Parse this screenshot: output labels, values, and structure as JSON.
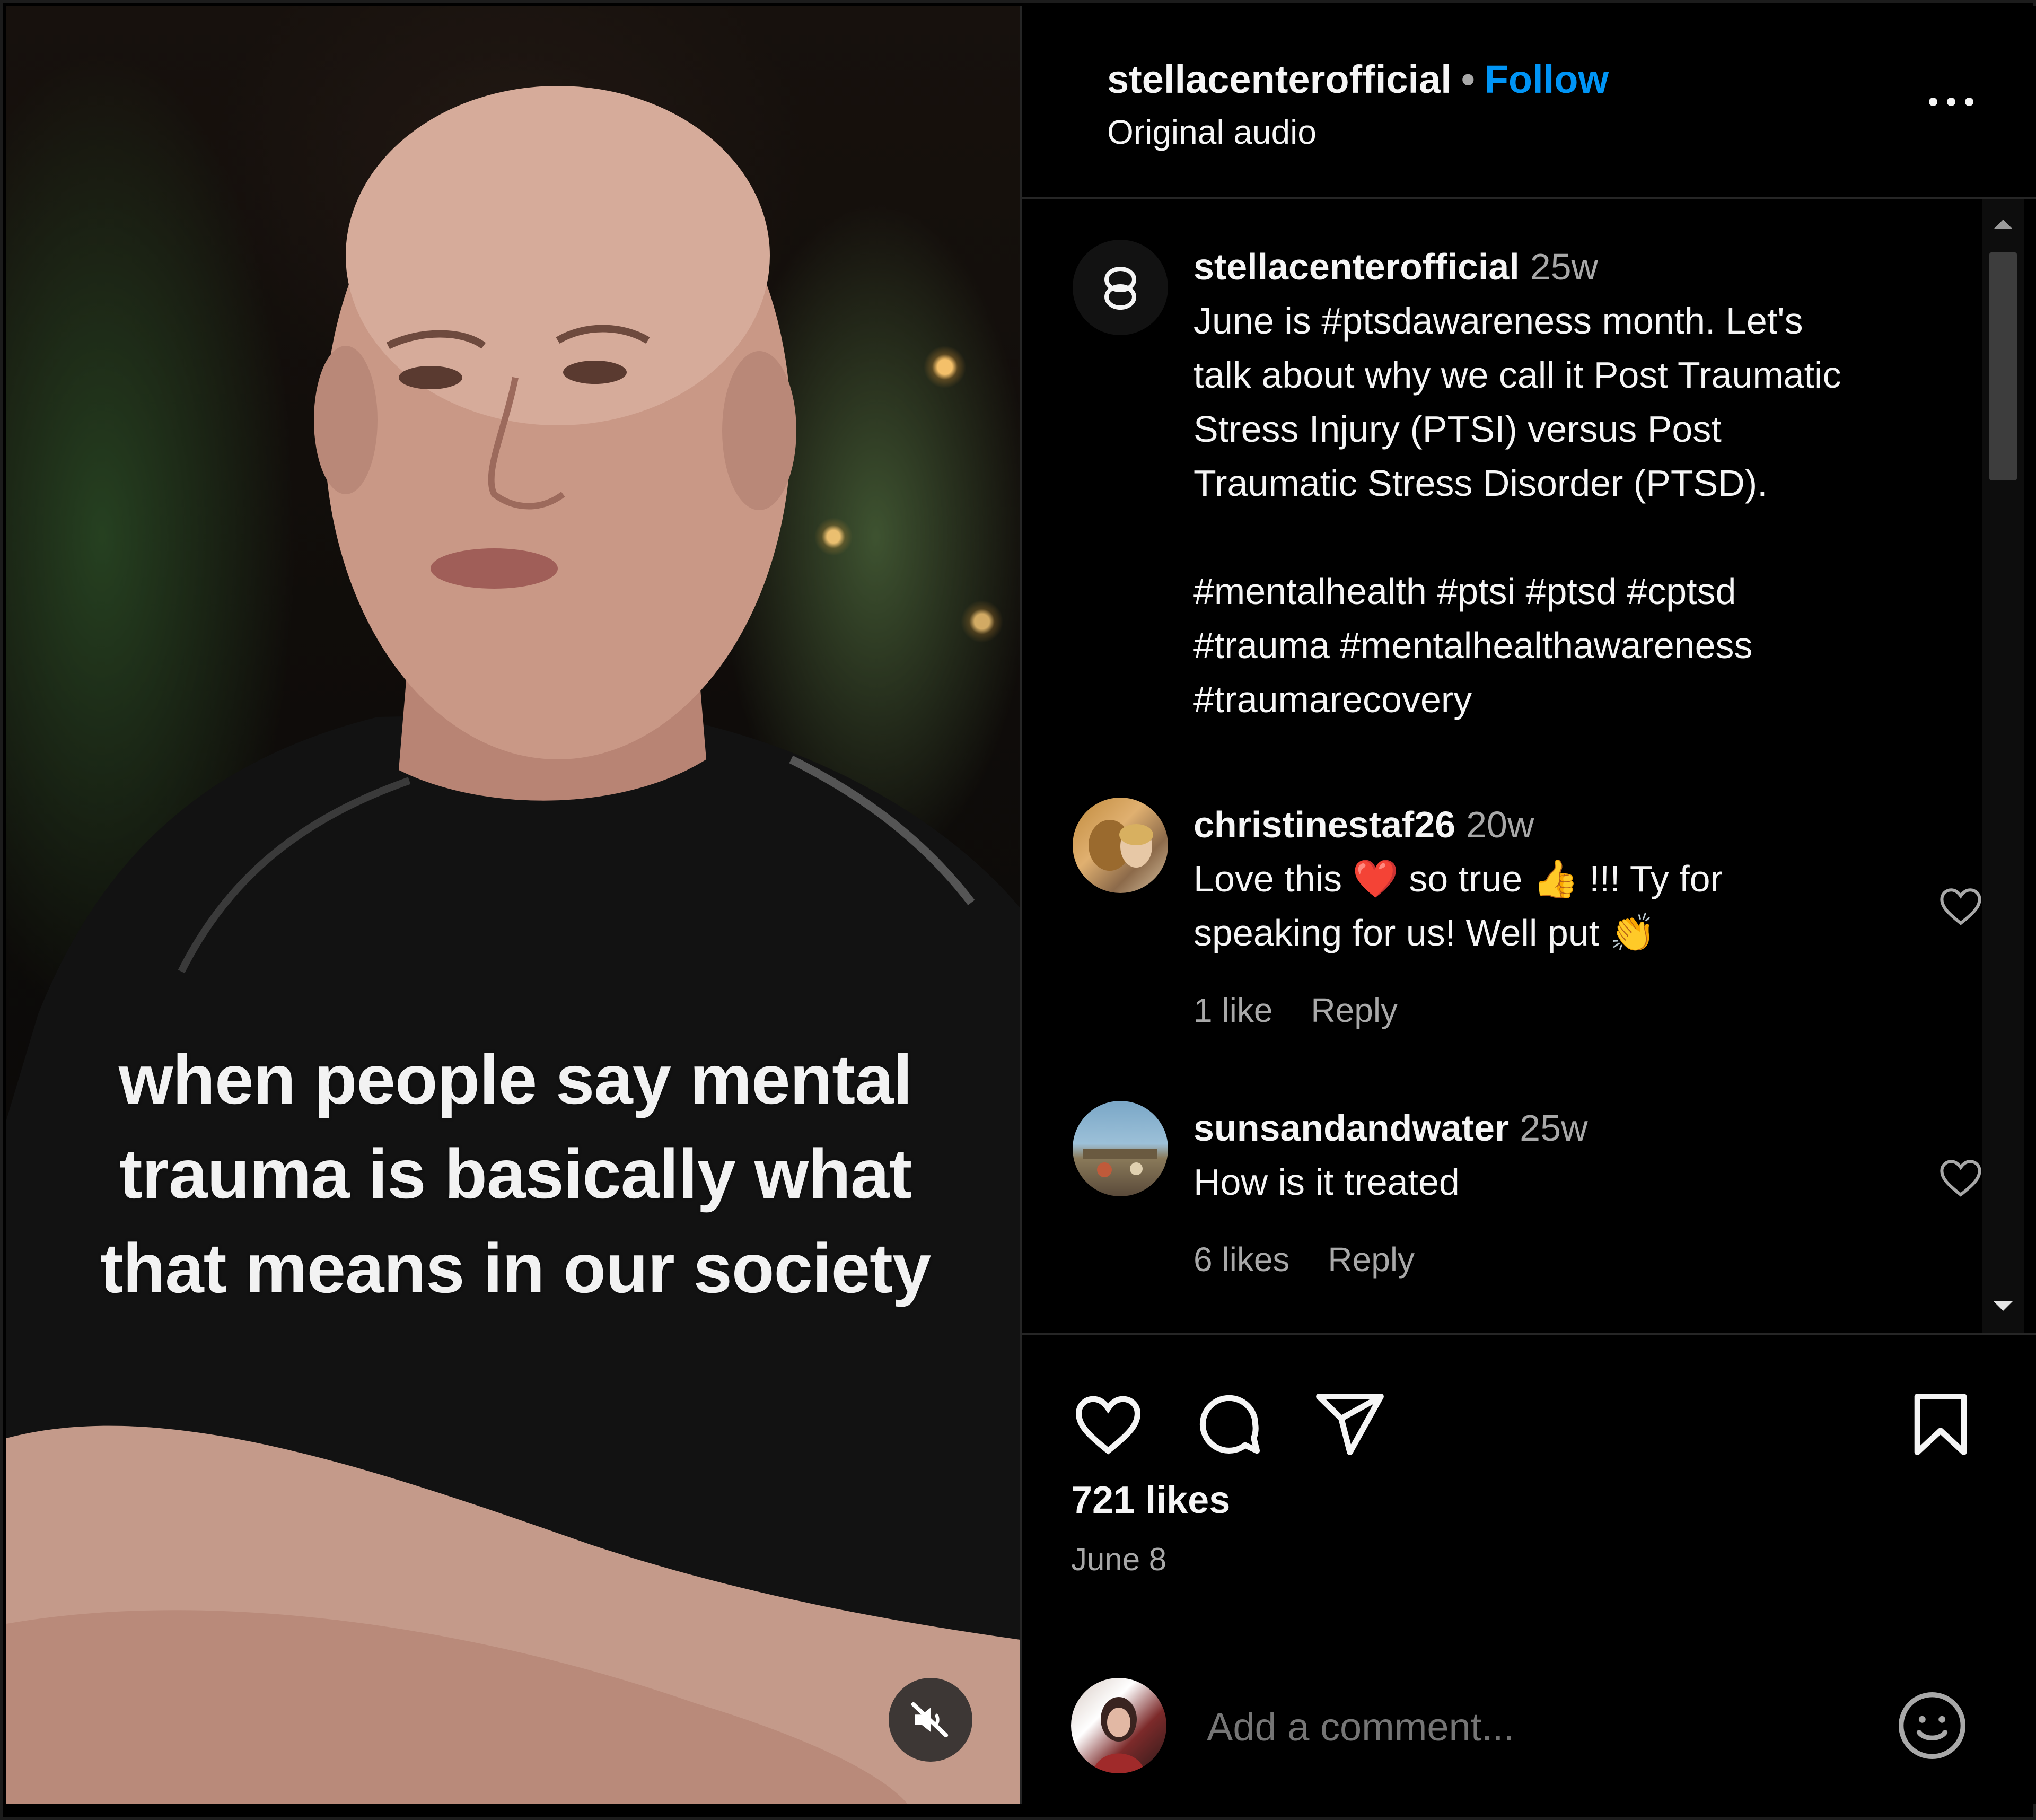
{
  "video": {
    "caption_lines": [
      "when people say mental",
      "trauma is basically what",
      "that means in our society"
    ],
    "mute_icon": "speaker-muted-icon"
  },
  "header": {
    "username": "stellacenterofficial",
    "separator": "•",
    "follow_label": "Follow",
    "audio_label": "Original audio",
    "more_icon": "more-horizontal-icon"
  },
  "post": {
    "username": "stellacenterofficial",
    "time": "25w",
    "text_lines": [
      "June is #ptsdawareness month. Let's",
      "talk about why we call it Post Traumatic",
      "Stress Injury (PTSI) versus Post",
      "Traumatic Stress Disorder (PTSD)."
    ],
    "hashtag_lines": [
      "#mentalhealth #ptsi #ptsd #cptsd",
      "#trauma #mentalhealthawareness",
      "#traumarecovery"
    ]
  },
  "comments": [
    {
      "username": "christinestaf26",
      "time": "20w",
      "line1_a": "Love this",
      "line1_emoji1": "❤️",
      "line1_b": "so true",
      "line1_emoji2": "👍",
      "line1_c": "!!! Ty for",
      "line2": "speaking for us! Well put",
      "line2_emoji": "👏",
      "likes": "1 like",
      "reply": "Reply"
    },
    {
      "username": "sunsandandwater",
      "time": "25w",
      "text": "How is it treated",
      "likes": "6 likes",
      "reply": "Reply"
    }
  ],
  "actions": {
    "likes": "721 likes",
    "date": "June 8",
    "comment_placeholder": "Add a comment..."
  },
  "colors": {
    "background": "#000000",
    "accent": "#0095f6",
    "text": "#f5f5f5",
    "muted": "#a8a8a8",
    "divider": "#262626"
  }
}
